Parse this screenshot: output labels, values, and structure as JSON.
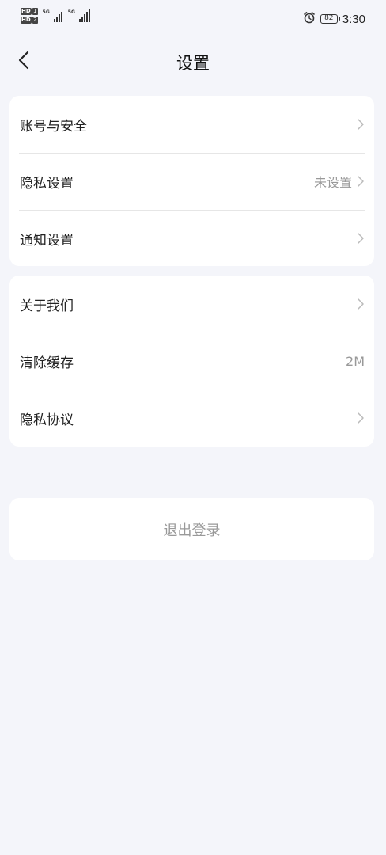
{
  "status_bar": {
    "sim1_badge": "HD",
    "sim1_num": "1",
    "sim2_badge": "HD",
    "sim2_num": "2",
    "net1": "5G",
    "net2": "5G",
    "battery": "82",
    "time": "3:30"
  },
  "nav": {
    "title": "设置"
  },
  "group1": [
    {
      "label": "账号与安全",
      "value": ""
    },
    {
      "label": "隐私设置",
      "value": "未设置"
    },
    {
      "label": "通知设置",
      "value": ""
    }
  ],
  "group2": [
    {
      "label": "关于我们",
      "value": ""
    },
    {
      "label": "清除缓存",
      "value": "2M"
    },
    {
      "label": "隐私协议",
      "value": ""
    }
  ],
  "logout": {
    "label": "退出登录"
  },
  "colors": {
    "background": "#f4f5fa",
    "card": "#ffffff",
    "secondary_text": "#999999"
  }
}
